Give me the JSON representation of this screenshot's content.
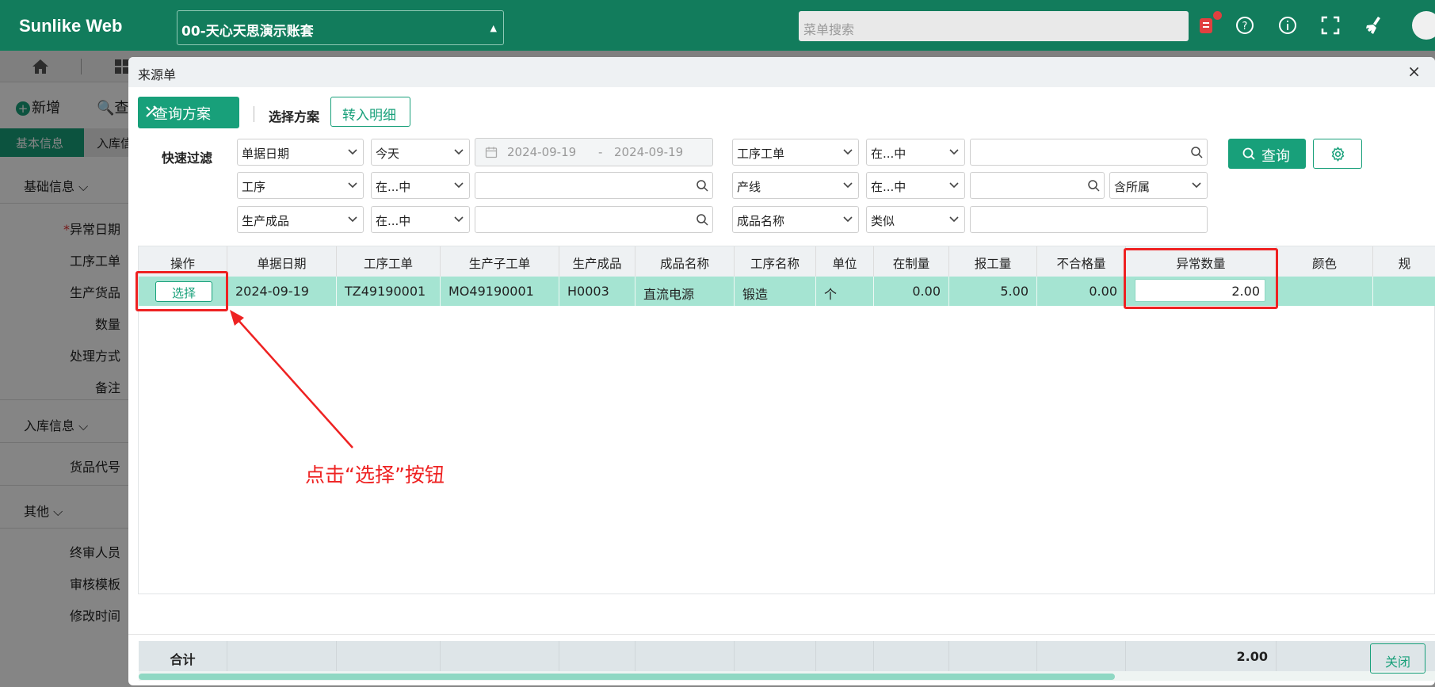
{
  "app": {
    "brand": "Sunlike Web",
    "account": "00-天心天思演示账套",
    "menu_search_placeholder": "菜单搜索",
    "accent_color": "#127c5c"
  },
  "background_page": {
    "toolbar": {
      "add": "新增",
      "query": "查"
    },
    "tabs": [
      "基本信息",
      "入库信"
    ],
    "sections": [
      {
        "title": "基础信息",
        "fields": [
          "异常日期",
          "工序工单",
          "生产货品",
          "数量",
          "处理方式",
          "备注"
        ]
      },
      {
        "title": "入库信息",
        "fields": [
          "货品代号"
        ]
      },
      {
        "title": "其他",
        "fields": [
          "终审人员",
          "审核模板",
          "修改时间"
        ]
      }
    ]
  },
  "modal": {
    "title": "来源单",
    "close_symbol": "×",
    "toolbar": {
      "scheme_button": "查询方案",
      "choose_scheme": "选择方案",
      "to_detail": "转入明细"
    },
    "quick_filter": {
      "label": "快速过滤",
      "row1": {
        "field": "单据日期",
        "op": "今天",
        "date_from": "2024-09-19",
        "date_sep": "-",
        "date_to": "2024-09-19",
        "field2": "工序工单",
        "op2": "在...中",
        "value2": ""
      },
      "row2": {
        "field": "工序",
        "op": "在...中",
        "value": "",
        "field2": "产线",
        "op2": "在...中",
        "value2": "",
        "extra": "含所属"
      },
      "row3": {
        "field": "生产成品",
        "op": "在...中",
        "value": "",
        "field2": "成品名称",
        "op2": "类似",
        "value2": ""
      },
      "query_button": "查询"
    },
    "grid": {
      "columns": [
        "操作",
        "单据日期",
        "工序工单",
        "生产子工单",
        "生产成品",
        "成品名称",
        "工序名称",
        "单位",
        "在制量",
        "报工量",
        "不合格量",
        "异常数量",
        "颜色",
        "规"
      ],
      "rows": [
        {
          "action": "选择",
          "date": "2024-09-19",
          "work_order": "TZ49190001",
          "sub_order": "MO49190001",
          "product": "H0003",
          "product_name": "直流电源",
          "process": "锻造",
          "unit": "个",
          "wip": "0.00",
          "reported": "5.00",
          "defective": "0.00",
          "abnormal_qty": "2.00",
          "color": ""
        }
      ],
      "footer": {
        "label": "合计",
        "abnormal_total": "2.00"
      },
      "selected_row_color": "#a5e4d2"
    },
    "annotation": {
      "text": "点击“选择”按钮",
      "color": "#ee2222"
    },
    "close_button": "关闭"
  }
}
